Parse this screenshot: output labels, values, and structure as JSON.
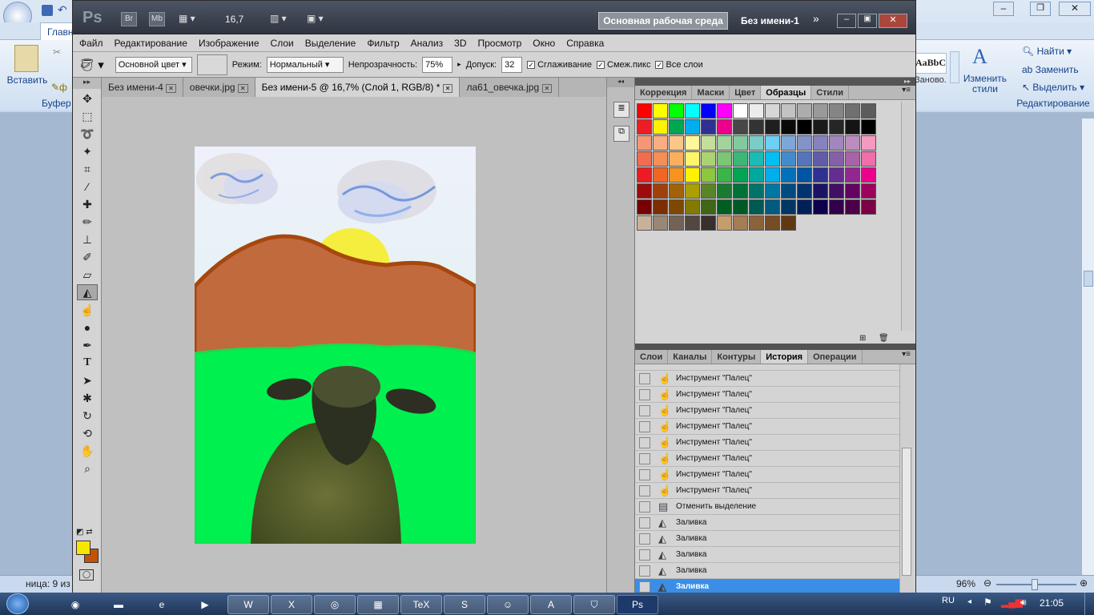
{
  "word": {
    "tab_home": "Главн",
    "paste": "Вставить",
    "clipboard": "Буфер о",
    "styles_preview": "AaBbCcl",
    "styles_preview2": "Заново...",
    "change_styles": "Изменить стили",
    "find": "Найти",
    "replace": "Заменить",
    "select": "Выделить",
    "editing": "Редактирование",
    "status_page": "ница: 9 из",
    "zoom": "96%"
  },
  "ps": {
    "logo": "Ps",
    "br": "Br",
    "mb": "Mb",
    "zoom_value": "16,7",
    "workspace": "Основная рабочая среда",
    "doc_title": "Без имени-1",
    "menu": [
      "Файл",
      "Редактирование",
      "Изображение",
      "Слои",
      "Выделение",
      "Фильтр",
      "Анализ",
      "3D",
      "Просмотр",
      "Окно",
      "Справка"
    ],
    "options": {
      "fill_source": "Основной цвет",
      "mode_label": "Режим:",
      "mode_value": "Нормальный",
      "opacity_label": "Непрозрачность:",
      "opacity_value": "75%",
      "tolerance_label": "Допуск:",
      "tolerance_value": "32",
      "antialias": "Сглаживание",
      "contiguous": "Смеж.пикс",
      "all_layers": "Все слои"
    },
    "doc_tabs": [
      "Без имени-4",
      "овечки.jpg",
      "Без имени-5 @ 16,7% (Слой 1, RGB/8) *",
      "ла61_овечка.jpg"
    ],
    "panel_top_tabs": [
      "Коррекция",
      "Маски",
      "Цвет",
      "Образцы",
      "Стили"
    ],
    "panel_bot_tabs": [
      "Слои",
      "Каналы",
      "Контуры",
      "История",
      "Операции"
    ],
    "history": [
      {
        "label": "Инструмент \"Палец\"",
        "icon": "smudge-icon"
      },
      {
        "label": "Инструмент \"Палец\"",
        "icon": "smudge-icon"
      },
      {
        "label": "Инструмент \"Палец\"",
        "icon": "smudge-icon"
      },
      {
        "label": "Инструмент \"Палец\"",
        "icon": "smudge-icon"
      },
      {
        "label": "Инструмент \"Палец\"",
        "icon": "smudge-icon"
      },
      {
        "label": "Инструмент \"Палец\"",
        "icon": "smudge-icon"
      },
      {
        "label": "Инструмент \"Палец\"",
        "icon": "smudge-icon"
      },
      {
        "label": "Инструмент \"Палец\"",
        "icon": "smudge-icon"
      },
      {
        "label": "Отменить выделение",
        "icon": "deselect-icon"
      },
      {
        "label": "Заливка",
        "icon": "bucket-icon"
      },
      {
        "label": "Заливка",
        "icon": "bucket-icon"
      },
      {
        "label": "Заливка",
        "icon": "bucket-icon"
      },
      {
        "label": "Заливка",
        "icon": "bucket-icon"
      },
      {
        "label": "Заливка",
        "icon": "bucket-icon"
      }
    ],
    "foreground_color": "#f7e600",
    "background_color": "#c2540a"
  },
  "swatches": [
    [
      "#ff0000",
      "#ffff00",
      "#00ff00",
      "#00ffff",
      "#0000ff",
      "#ff00ff",
      "#ffffff",
      "#ebebeb",
      "#d6d6d6",
      "#c2c2c2",
      "#adadad",
      "#999999",
      "#858585",
      "#707070",
      "#5c5c5c"
    ],
    [
      "#ee1c24",
      "#fff200",
      "#00a651",
      "#00aeef",
      "#2e3192",
      "#ec008c",
      "#474747",
      "#333333",
      "#1f1f1f",
      "#0a0a0a",
      "#000000",
      "#1a1a1a",
      "#262626",
      "#141414",
      "#000000"
    ],
    [
      "#f69679",
      "#f9ad81",
      "#fdc689",
      "#fff799",
      "#c4df9b",
      "#a3d39c",
      "#82ca9d",
      "#7accc8",
      "#6dcff6",
      "#7da7d9",
      "#8393ca",
      "#8781bd",
      "#a187be",
      "#bd8cbf",
      "#f49ac1"
    ],
    [
      "#f26c4f",
      "#f68e56",
      "#fbaf5d",
      "#fff568",
      "#acd373",
      "#7cc576",
      "#3bb878",
      "#1abbb4",
      "#00bff3",
      "#438ccb",
      "#5574b9",
      "#605ca8",
      "#855fa8",
      "#a763a8",
      "#f06ea9"
    ],
    [
      "#ed1c24",
      "#f26522",
      "#f7941d",
      "#fff200",
      "#8dc73f",
      "#39b54a",
      "#00a651",
      "#00a99d",
      "#00aeef",
      "#0072bc",
      "#0054a6",
      "#2e3192",
      "#662d91",
      "#92278f",
      "#ec008c"
    ],
    [
      "#9e0b0f",
      "#a0410d",
      "#a36209",
      "#aba000",
      "#598527",
      "#1a7b30",
      "#007236",
      "#00746b",
      "#0076a3",
      "#004b80",
      "#003471",
      "#1b1464",
      "#440e62",
      "#630460",
      "#9e005d"
    ],
    [
      "#790000",
      "#7b2e00",
      "#7d4900",
      "#827b00",
      "#406618",
      "#005e20",
      "#005826",
      "#005952",
      "#005b7f",
      "#003663",
      "#002157",
      "#0d004c",
      "#32004b",
      "#4b0049",
      "#7b0046"
    ],
    [
      "#c7b299",
      "#998675",
      "#736357",
      "#534741",
      "#37302d",
      "#c69c6d",
      "#a67c52",
      "#8c6239",
      "#754c24",
      "#603913"
    ]
  ],
  "taskbar": {
    "lang": "RU",
    "clock": "21:05",
    "apps": [
      "firefox-icon",
      "explorer-icon",
      "ie-icon",
      "media-icon",
      "word-icon",
      "excel-icon",
      "chrome-icon",
      "calculator-icon",
      "tex-icon",
      "skype-icon",
      "people-icon",
      "acrobat-icon",
      "security-icon",
      "photoshop-icon"
    ],
    "app_labels": {
      "tex": "TeX",
      "ps": "Ps"
    }
  }
}
